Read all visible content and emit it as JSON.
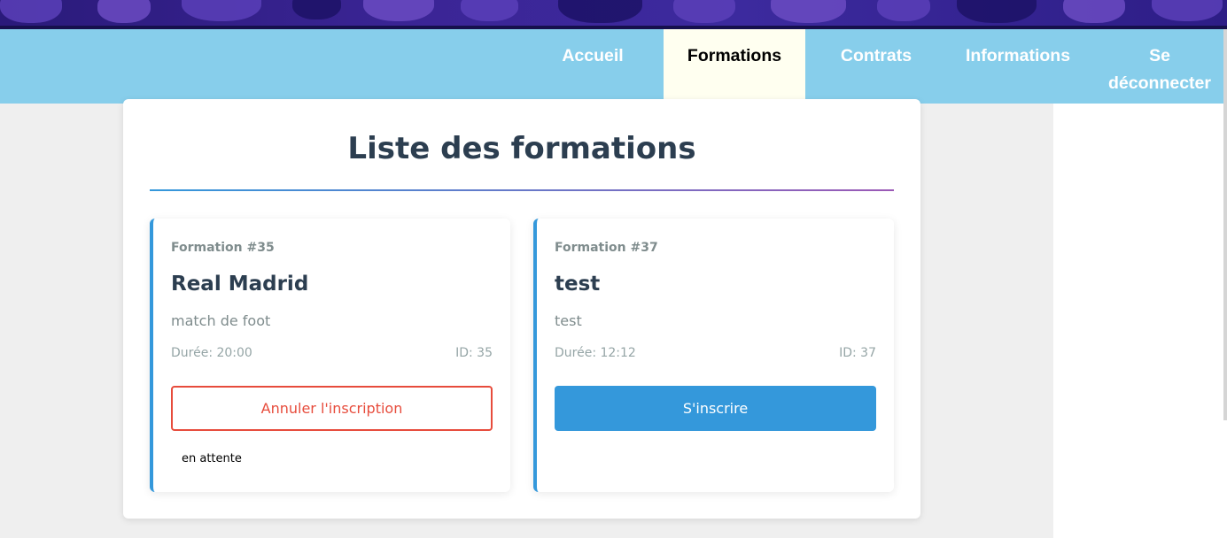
{
  "colors": {
    "nav_bg": "#87ceeb",
    "nav_active_bg": "#fffff0",
    "accent": "#3498db",
    "danger": "#e74c3c",
    "title": "#2c3e50",
    "banner": "#3b2596"
  },
  "nav": {
    "items": [
      {
        "label": "Accueil"
      },
      {
        "label": "Formations",
        "active": true
      },
      {
        "label": "Contrats"
      },
      {
        "label": "Informations"
      },
      {
        "label": "Se déconnecter"
      }
    ]
  },
  "main": {
    "title": "Liste des formations",
    "formations": [
      {
        "number_label": "Formation #35",
        "title": "Real Madrid",
        "description": "match de foot",
        "duration": "Durée: 20:00",
        "id_label": "ID: 35",
        "button_label": "Annuler l'inscription",
        "status": "en attente"
      },
      {
        "number_label": "Formation #37",
        "title": "test",
        "description": "test",
        "duration": "Durée: 12:12",
        "id_label": "ID: 37",
        "button_label": "S'inscrire"
      }
    ]
  }
}
